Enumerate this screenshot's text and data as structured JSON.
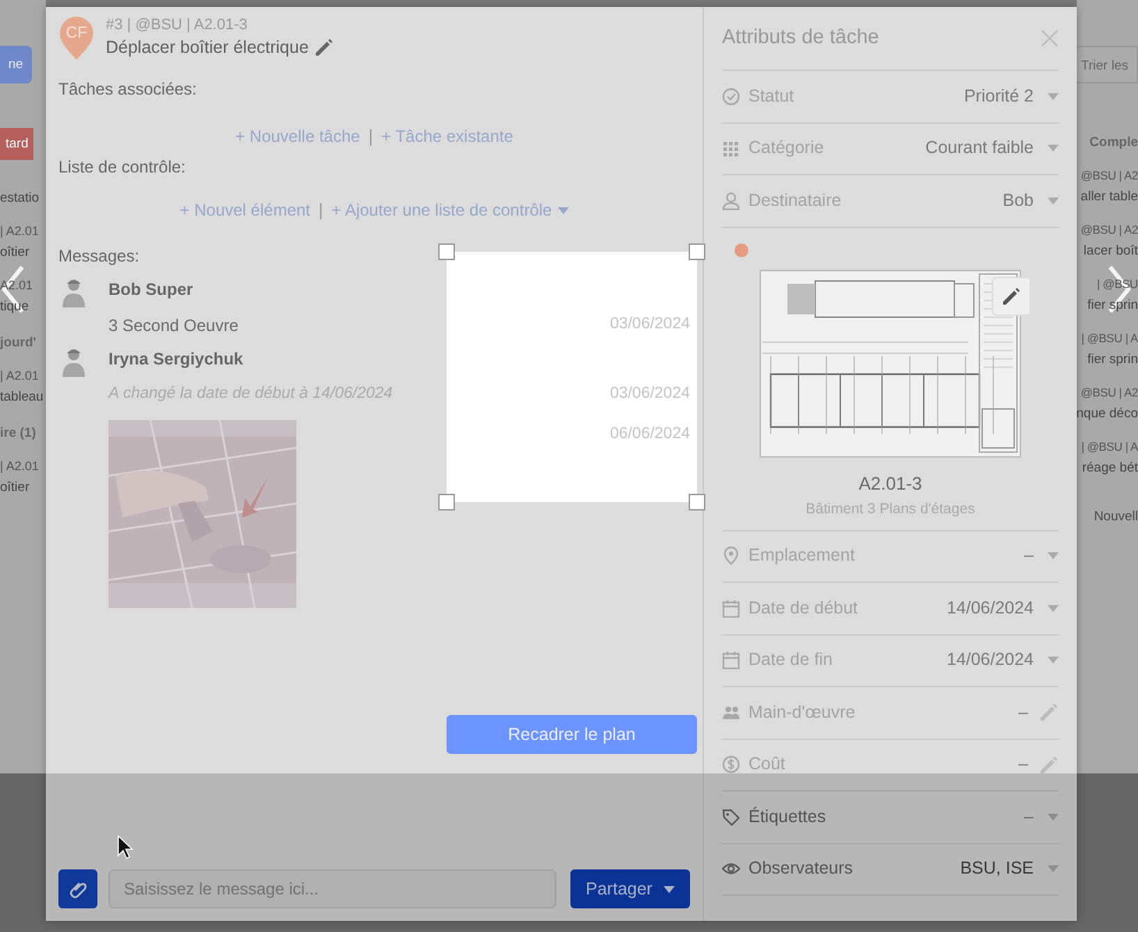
{
  "background": {
    "left": [
      {
        "kind": "button",
        "text": "ne"
      },
      {
        "kind": "tag",
        "text": "tard"
      },
      {
        "kind": "title",
        "text": "estatio"
      },
      {
        "kind": "meta",
        "text": "| A2.01"
      },
      {
        "kind": "title",
        "text": "oîtier"
      },
      {
        "kind": "meta",
        "text": "A2.01"
      },
      {
        "kind": "title",
        "text": "tique"
      },
      {
        "kind": "header",
        "text": "jourd'"
      },
      {
        "kind": "meta",
        "text": "| A2.01"
      },
      {
        "kind": "title",
        "text": "tableau"
      },
      {
        "kind": "header",
        "text": "ire (1)"
      },
      {
        "kind": "meta",
        "text": "| A2.01"
      },
      {
        "kind": "title",
        "text": "oîtier"
      }
    ],
    "right": [
      {
        "kind": "button",
        "text": "Trier les"
      },
      {
        "kind": "header",
        "text": "Comple"
      },
      {
        "kind": "meta",
        "text": "@BSU | A2"
      },
      {
        "kind": "title",
        "text": "aller table"
      },
      {
        "kind": "meta",
        "text": "@BSU | A2"
      },
      {
        "kind": "title",
        "text": "lacer boît"
      },
      {
        "kind": "meta",
        "text": "| @BSU"
      },
      {
        "kind": "title",
        "text": "fier sprin"
      },
      {
        "kind": "meta",
        "text": "| @BSU | A"
      },
      {
        "kind": "title",
        "text": "fier sprin"
      },
      {
        "kind": "meta",
        "text": "@BSU | A2"
      },
      {
        "kind": "title",
        "text": "nque déco"
      },
      {
        "kind": "meta",
        "text": "| @BSU | A"
      },
      {
        "kind": "title",
        "text": "réage bét"
      },
      {
        "kind": "link",
        "text": "Nouvell"
      }
    ]
  },
  "task": {
    "avatar": "CF",
    "meta": "#3 | @BSU | A2.01-3",
    "title": "Déplacer boîtier électrique"
  },
  "related_tasks": {
    "label": "Tâches associées:",
    "separator": "|",
    "actions": [
      "+ Nouvelle tâche",
      "+ Tâche existante"
    ]
  },
  "checklist": {
    "label": "Liste de contrôle:",
    "separator": "|",
    "actions": [
      "+ Nouvel élément",
      "+ Ajouter une liste de contrôle"
    ]
  },
  "messages": {
    "label": "Messages:",
    "items": [
      {
        "kind": "text",
        "author": "Bob Super",
        "text": "3 Second Oeuvre",
        "date": "03/06/2024"
      },
      {
        "kind": "event",
        "author": "Iryna Sergiychuk",
        "text": "A changé la date de début à 14/06/2024",
        "date": "03/06/2024"
      },
      {
        "date": "06/06/2024"
      }
    ]
  },
  "crop": {
    "button": "Recadrer le plan"
  },
  "composer": {
    "placeholder": "Saisissez le message ici...",
    "send": "Partager"
  },
  "attributes": {
    "title": "Attributs de tâche",
    "rows": [
      {
        "kind": "status",
        "label": "Statut",
        "value": "Priorité 2",
        "editable": false
      },
      {
        "kind": "category",
        "label": "Catégorie",
        "value": "Courant faible",
        "editable": false
      },
      {
        "kind": "assignee",
        "label": "Destinataire",
        "value": "Bob",
        "editable": false
      },
      {
        "kind": "plan",
        "sheet": "A2.01-3",
        "caption": "Bâtiment 3 Plans d'étages"
      },
      {
        "kind": "location",
        "label": "Emplacement",
        "value": "–",
        "editable": false
      },
      {
        "kind": "date",
        "label": "Date de début",
        "value": "14/06/2024",
        "editable": false
      },
      {
        "kind": "date",
        "label": "Date de fin",
        "value": "14/06/2024",
        "editable": false
      },
      {
        "kind": "labor",
        "label": "Main-d'œuvre",
        "value": "–",
        "editable": true
      },
      {
        "kind": "cost",
        "label": "Coût",
        "value": "–",
        "editable": true
      },
      {
        "kind": "tags",
        "label": "Étiquettes",
        "value": "–",
        "editable": false
      },
      {
        "kind": "watchers",
        "label": "Observateurs",
        "value": "BSU, ISE",
        "editable": false
      }
    ]
  }
}
